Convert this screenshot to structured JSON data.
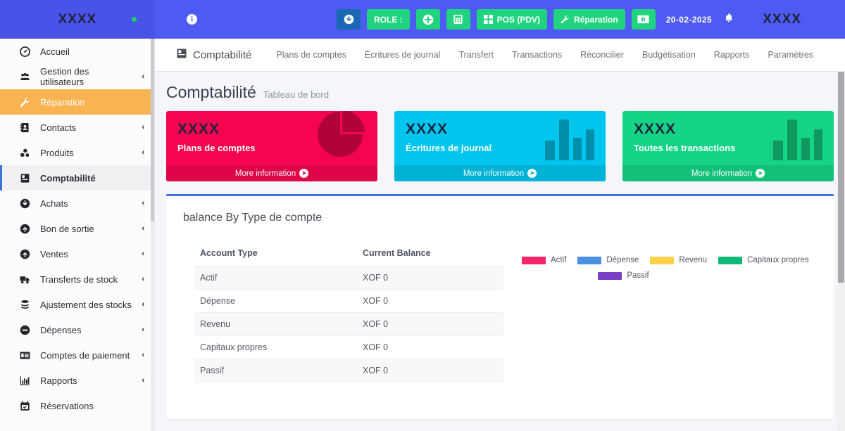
{
  "brand": {
    "name": "XXXX",
    "status_dot_color": "#19d26b"
  },
  "topbar": {
    "hamburger_label": "menu",
    "info_label": "i",
    "buttons": [
      {
        "name": "download-button",
        "label": "",
        "icon": "download-circle-icon",
        "color": "#1a67b3"
      },
      {
        "name": "role-button",
        "label": "ROLE :",
        "icon": "",
        "color": "#20d37f"
      },
      {
        "name": "add-button",
        "label": "",
        "icon": "plus-circle-icon",
        "color": "#20d37f"
      },
      {
        "name": "calculator-button",
        "label": "",
        "icon": "calculator-icon",
        "color": "#20d37f"
      },
      {
        "name": "pos-button",
        "label": "POS (PDV)",
        "icon": "grid-icon",
        "color": "#20d37f"
      },
      {
        "name": "repair-button",
        "label": "Réparation",
        "icon": "wrench-icon",
        "color": "#20d37f"
      },
      {
        "name": "cash-button",
        "label": "",
        "icon": "money-icon",
        "color": "#20d37f"
      }
    ],
    "date": "20-02-2025",
    "notification_icon": "bell-icon",
    "user": "XXXX"
  },
  "sidebar": {
    "items": [
      {
        "label": "Accueil",
        "icon": "dashboard-icon",
        "caret": "",
        "state": ""
      },
      {
        "label": "Gestion des utilisateurs",
        "icon": "users-icon",
        "caret": "‹",
        "state": ""
      },
      {
        "label": "Réparation",
        "icon": "wrench-icon",
        "caret": "",
        "state": "active-orange"
      },
      {
        "label": "Contacts",
        "icon": "contact-book-icon",
        "caret": "‹",
        "state": ""
      },
      {
        "label": "Produits",
        "icon": "products-icon",
        "caret": "‹",
        "state": ""
      },
      {
        "label": "Comptabilité",
        "icon": "book-icon",
        "caret": "",
        "state": "active-gray"
      },
      {
        "label": "Achats",
        "icon": "arrow-down-circle-icon",
        "caret": "‹",
        "state": ""
      },
      {
        "label": "Bon de sortie",
        "icon": "arrow-up-circle-icon",
        "caret": "‹",
        "state": ""
      },
      {
        "label": "Ventes",
        "icon": "arrow-up-circle-icon",
        "caret": "‹",
        "state": ""
      },
      {
        "label": "Transferts de stock",
        "icon": "truck-icon",
        "caret": "‹",
        "state": ""
      },
      {
        "label": "Ajustement des stocks",
        "icon": "stack-icon",
        "caret": "‹",
        "state": ""
      },
      {
        "label": "Dépenses",
        "icon": "minus-circle-icon",
        "caret": "‹",
        "state": ""
      },
      {
        "label": "Comptes de paiement",
        "icon": "card-icon",
        "caret": "‹",
        "state": ""
      },
      {
        "label": "Rapports",
        "icon": "bar-chart-icon",
        "caret": "‹",
        "state": ""
      },
      {
        "label": "Réservations",
        "icon": "calendar-icon",
        "caret": "",
        "state": ""
      }
    ]
  },
  "tabbar": {
    "title": "Comptabilité",
    "title_icon": "book-icon",
    "tabs": [
      {
        "label": "Plans de comptes"
      },
      {
        "label": "Écritures de journal"
      },
      {
        "label": "Transfert"
      },
      {
        "label": "Transactions"
      },
      {
        "label": "Réconcilier"
      },
      {
        "label": "Budgétisation"
      },
      {
        "label": "Rapports"
      },
      {
        "label": "Paramètres"
      }
    ]
  },
  "page": {
    "title": "Comptabilité",
    "subtitle": "Tableau de bord",
    "cards": [
      {
        "value": "XXXX",
        "label": "Plans de comptes",
        "more": "More information",
        "icon": "pie-chart-icon",
        "color": "#f5054f"
      },
      {
        "value": "XXXX",
        "label": "Écritures de journal",
        "more": "More information",
        "icon": "bar-chart-icon",
        "color": "#00c6ed"
      },
      {
        "value": "XXXX",
        "label": "Toutes les transactions",
        "more": "More information",
        "icon": "bar-chart-icon",
        "color": "#16d486"
      }
    ]
  },
  "chart_data": {
    "type": "table",
    "title": "balance By Type de compte",
    "columns": [
      "Account Type",
      "Current Balance"
    ],
    "categories": [
      "Actif",
      "Dépense",
      "Revenu",
      "Capitaux propres",
      "Passif"
    ],
    "values": [
      0,
      0,
      0,
      0,
      0
    ],
    "currency": "XOF",
    "rows": [
      {
        "type": "Actif",
        "balance": "XOF 0"
      },
      {
        "type": "Dépense",
        "balance": "XOF 0"
      },
      {
        "type": "Revenu",
        "balance": "XOF 0"
      },
      {
        "type": "Capitaux propres",
        "balance": "XOF 0"
      },
      {
        "type": "Passif",
        "balance": "XOF 0"
      }
    ],
    "legend_position": "right",
    "legend": [
      {
        "label": "Actif",
        "color": "#f6246b"
      },
      {
        "label": "Dépense",
        "color": "#4a90e2"
      },
      {
        "label": "Revenu",
        "color": "#fcd34a"
      },
      {
        "label": "Capitaux propres",
        "color": "#11b978"
      },
      {
        "label": "Passif",
        "color": "#7b3fc4"
      }
    ]
  }
}
